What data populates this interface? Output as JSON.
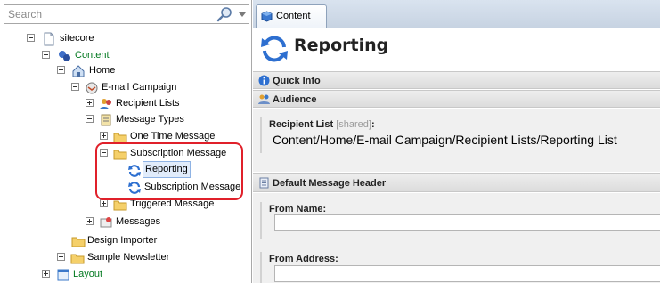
{
  "search": {
    "placeholder": "Search"
  },
  "tree": {
    "nodes": [
      {
        "label": "sitecore"
      },
      {
        "label": "Content"
      },
      {
        "label": "Home"
      },
      {
        "label": "E-mail Campaign"
      },
      {
        "label": "Recipient Lists"
      },
      {
        "label": "Message Types"
      },
      {
        "label": "One Time Message"
      },
      {
        "label": "Subscription Message"
      },
      {
        "label": "Reporting"
      },
      {
        "label": "Subscription Message"
      },
      {
        "label": "Triggered Message"
      },
      {
        "label": "Messages"
      },
      {
        "label": "Design Importer"
      },
      {
        "label": "Sample Newsletter"
      },
      {
        "label": "Layout"
      }
    ]
  },
  "tabs": [
    {
      "label": "Content"
    }
  ],
  "item": {
    "title": "Reporting"
  },
  "sections": {
    "quick_info": "Quick Info",
    "audience": "Audience",
    "default_header": "Default Message Header"
  },
  "fields": {
    "recipient_list": {
      "label": "Recipient List",
      "shared": "[shared]",
      "colon": ":",
      "value": "Content/Home/E-mail Campaign/Recipient Lists/Reporting List"
    },
    "from_name": {
      "label": "From Name:",
      "value": ""
    },
    "from_address": {
      "label": "From Address:",
      "value": ""
    }
  },
  "colors": {
    "highlight": "#e0202a",
    "content_green": "#00781e",
    "selected_bg": "#e1ecfb"
  }
}
